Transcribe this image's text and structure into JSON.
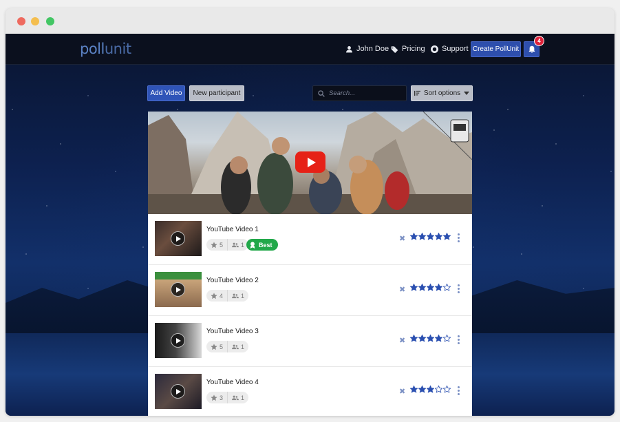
{
  "window": {
    "controls": [
      "close",
      "minimize",
      "maximize"
    ]
  },
  "navbar": {
    "logo_left": "poll",
    "logo_right": "unit",
    "user": "John Doe",
    "pricing": "Pricing",
    "support": "Support",
    "create_button": "Create PollUnit",
    "notifications_count": "4"
  },
  "toolbar": {
    "add_video": "Add Video",
    "new_participant": "New participant",
    "search_placeholder": "Search...",
    "sort_options": "Sort options"
  },
  "hero": {
    "icon": "youtube-play-icon"
  },
  "videos": [
    {
      "title": "YouTube Video 1",
      "rating_count": "5",
      "participants": "1",
      "best_label": "Best",
      "stars": 5
    },
    {
      "title": "YouTube Video 2",
      "rating_count": "4",
      "participants": "1",
      "stars": 4
    },
    {
      "title": "YouTube Video 3",
      "rating_count": "5",
      "participants": "1",
      "stars": 4
    },
    {
      "title": "YouTube Video 4",
      "rating_count": "3",
      "participants": "1",
      "stars": 3
    }
  ],
  "colors": {
    "accent": "#2e4fad",
    "star": "#2a4fb0",
    "best": "#22a84a",
    "badge": "#e0233b"
  }
}
